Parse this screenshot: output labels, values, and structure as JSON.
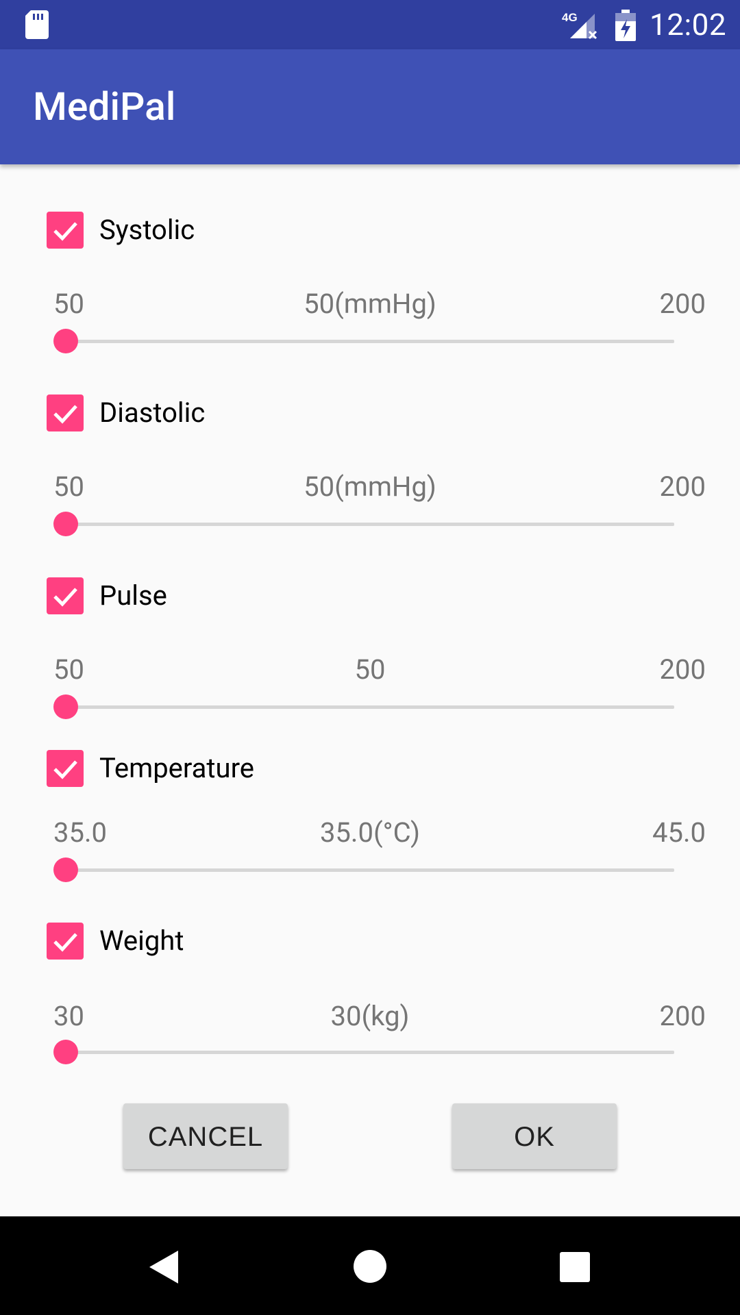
{
  "status_bar": {
    "time": "12:02",
    "network": "4G",
    "icons": [
      "sd-card-icon",
      "signal-no-service-icon",
      "battery-charging-icon"
    ]
  },
  "app_bar": {
    "title": "MediPal"
  },
  "colors": {
    "primary": "#3f51b5",
    "primary_dark": "#303f9f",
    "accent": "#ff4081"
  },
  "filters": [
    {
      "label": "Systolic",
      "checked": true,
      "min": "50",
      "current": "50(mmHg)",
      "max": "200",
      "level": 0
    },
    {
      "label": "Diastolic",
      "checked": true,
      "min": "50",
      "current": "50(mmHg)",
      "max": "200",
      "level": 0
    },
    {
      "label": "Pulse",
      "checked": true,
      "min": "50",
      "current": "50",
      "max": "200",
      "level": 0
    },
    {
      "label": "Temperature",
      "checked": true,
      "min": "35.0",
      "current": "35.0(°C)",
      "max": "45.0",
      "level": 0
    },
    {
      "label": "Weight",
      "checked": true,
      "min": "30",
      "current": "30(kg)",
      "max": "200",
      "level": 0
    }
  ],
  "actions": {
    "cancel": "CANCEL",
    "ok": "OK"
  },
  "nav_bar": {
    "icons": [
      "back-icon",
      "home-icon",
      "recents-icon"
    ]
  }
}
